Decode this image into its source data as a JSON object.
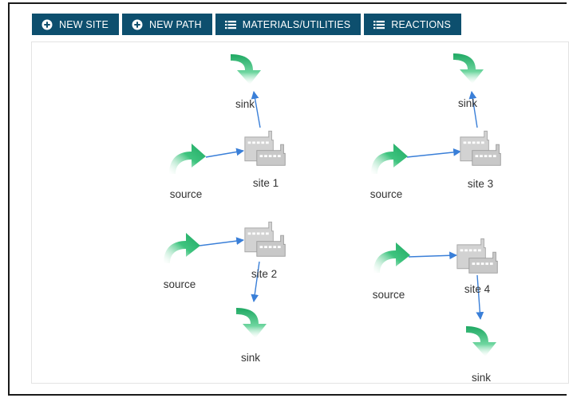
{
  "toolbar": {
    "new_site": "NEW SITE",
    "new_path": "NEW PATH",
    "materials_utilities": "MATERIALS/UTILITIES",
    "reactions": "REACTIONS"
  },
  "colors": {
    "toolbar_bg": "#0d4f6e",
    "edge": "#3a7fd8",
    "node_arrow": "#2bb673",
    "factory": "#cfcfcf"
  },
  "graph": {
    "nodes": [
      {
        "id": "site1",
        "type": "site",
        "label": "site 1"
      },
      {
        "id": "site2",
        "type": "site",
        "label": "site 2"
      },
      {
        "id": "site3",
        "type": "site",
        "label": "site 3"
      },
      {
        "id": "site4",
        "type": "site",
        "label": "site 4"
      },
      {
        "id": "src1",
        "type": "source",
        "label": "source"
      },
      {
        "id": "src2",
        "type": "source",
        "label": "source"
      },
      {
        "id": "src3",
        "type": "source",
        "label": "source"
      },
      {
        "id": "src4",
        "type": "source",
        "label": "source"
      },
      {
        "id": "sink1",
        "type": "sink",
        "label": "sink"
      },
      {
        "id": "sink2",
        "type": "sink",
        "label": "sink"
      },
      {
        "id": "sink3",
        "type": "sink",
        "label": "sink"
      },
      {
        "id": "sink4",
        "type": "sink",
        "label": "sink"
      }
    ],
    "edges": [
      {
        "from": "src1",
        "to": "site1"
      },
      {
        "from": "site1",
        "to": "sink1"
      },
      {
        "from": "src2",
        "to": "site2"
      },
      {
        "from": "site2",
        "to": "sink2"
      },
      {
        "from": "src3",
        "to": "site3"
      },
      {
        "from": "site3",
        "to": "sink3"
      },
      {
        "from": "src4",
        "to": "site4"
      },
      {
        "from": "site4",
        "to": "sink4"
      }
    ]
  }
}
